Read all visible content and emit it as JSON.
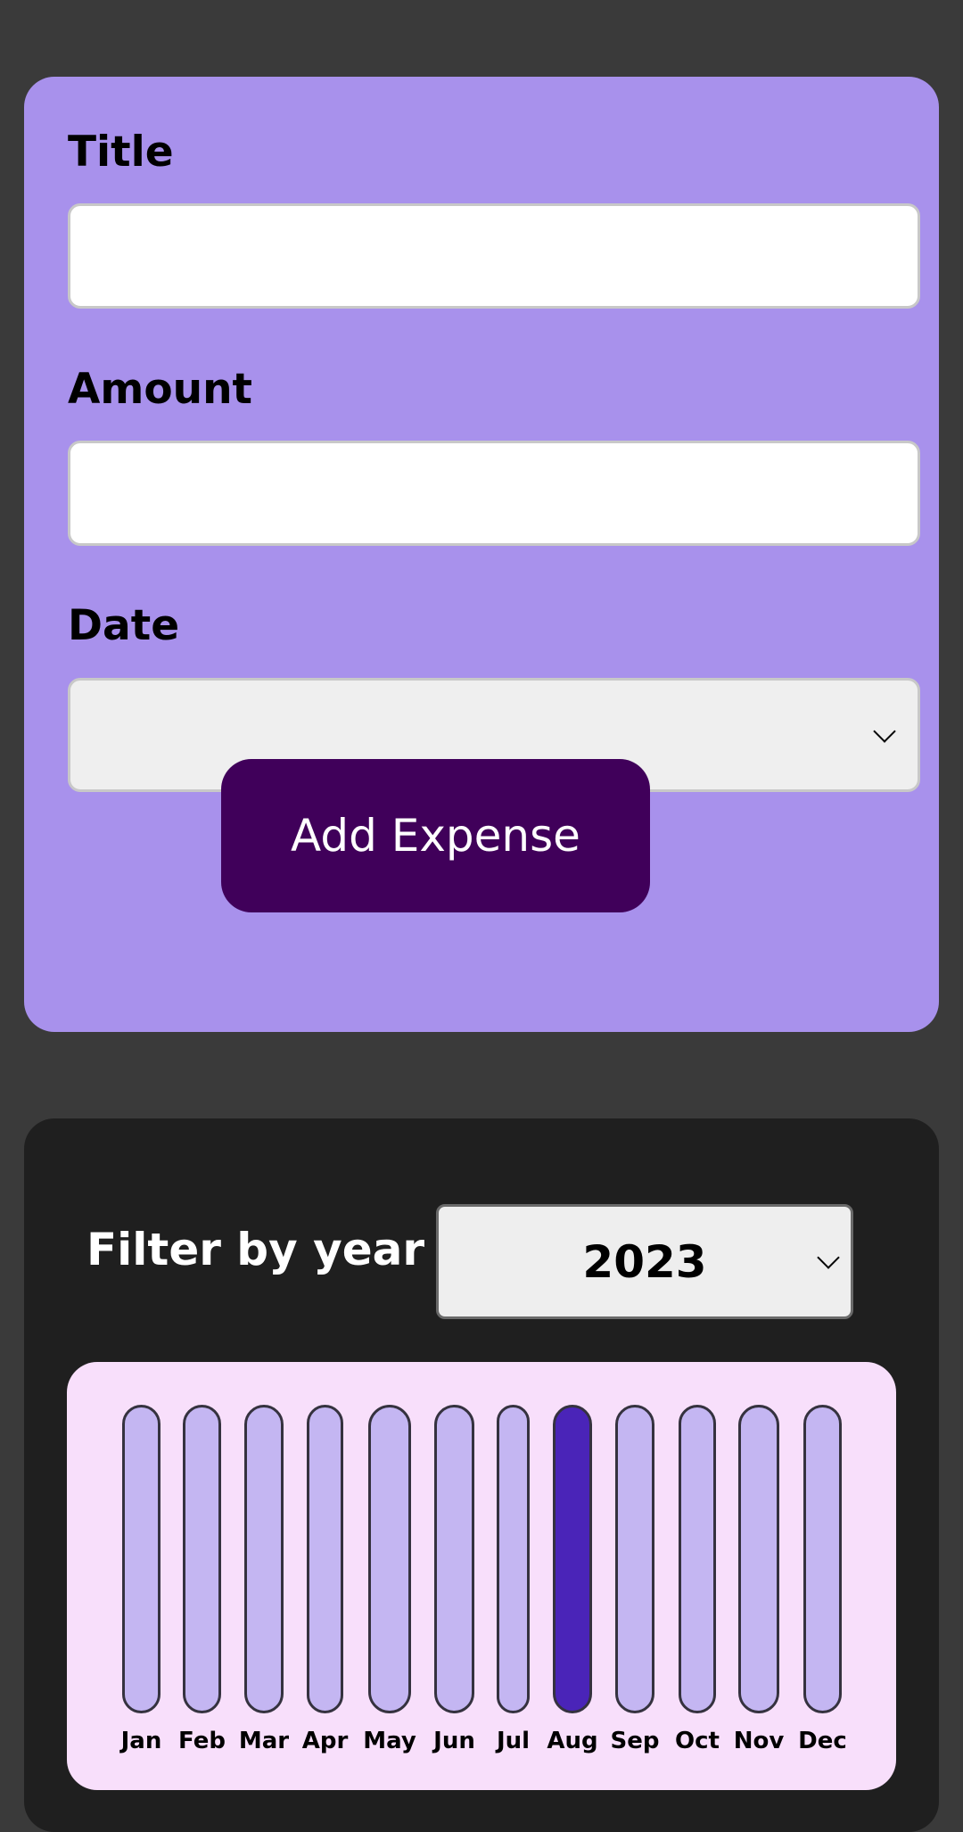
{
  "form": {
    "title_label": "Title",
    "title_value": "",
    "amount_label": "Amount",
    "amount_value": "",
    "date_label": "Date",
    "date_value": "",
    "submit_label": "Add Expense"
  },
  "filter": {
    "label": "Filter by year",
    "selected_year": "2023"
  },
  "colors": {
    "form_background": "#a891ec",
    "button_background": "#40005a",
    "chart_background": "#f8dffb",
    "bar_inactive": "#c4b6f2",
    "bar_active": "#4a24b8"
  },
  "chart_data": {
    "type": "bar",
    "categories": [
      "Jan",
      "Feb",
      "Mar",
      "Apr",
      "May",
      "Jun",
      "Jul",
      "Aug",
      "Sep",
      "Oct",
      "Nov",
      "Dec"
    ],
    "highlighted": "Aug",
    "grid": false
  }
}
